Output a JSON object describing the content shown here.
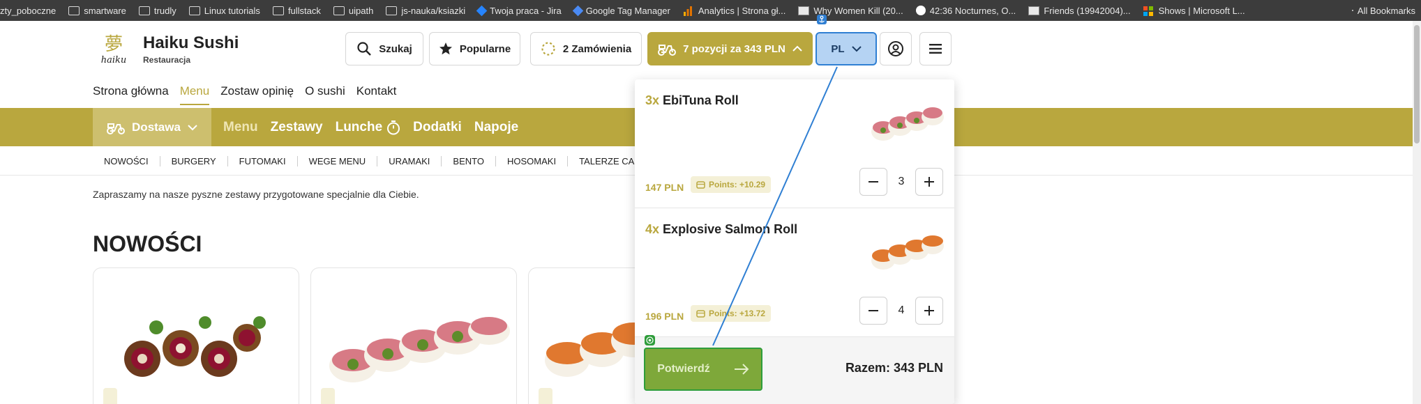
{
  "browser": {
    "bookmarks": [
      {
        "label": "zty_poboczne",
        "icon": "folder-icon"
      },
      {
        "label": "smartware",
        "icon": "folder-icon"
      },
      {
        "label": "trudly",
        "icon": "folder-icon"
      },
      {
        "label": "Linux tutorials",
        "icon": "folder-icon"
      },
      {
        "label": "fullstack",
        "icon": "folder-icon"
      },
      {
        "label": "uipath",
        "icon": "folder-icon"
      },
      {
        "label": "js-nauka/ksiazki",
        "icon": "folder-icon"
      },
      {
        "label": "Twoja praca - Jira",
        "icon": "jira-icon"
      },
      {
        "label": "Google Tag Manager",
        "icon": "gtm-icon"
      },
      {
        "label": "Analytics | Strona gł...",
        "icon": "analytics-icon"
      },
      {
        "label": "Why Women Kill (20...",
        "icon": "site-icon"
      },
      {
        "label": "42:36 Nocturnes, O...",
        "icon": "google-icon"
      },
      {
        "label": "Friends (19942004)...",
        "icon": "site-icon"
      },
      {
        "label": "Shows | Microsoft L...",
        "icon": "microsoft-icon"
      }
    ],
    "all_bookmarks": "All Bookmarks"
  },
  "brand": {
    "title": "Haiku Sushi",
    "subtitle": "Restauracja",
    "logo_text": "haiku"
  },
  "header": {
    "search": "Szukaj",
    "popular": "Popularne",
    "orders": "2 Zamówienia",
    "cart": "7 pozycji za 343 PLN",
    "language": "PL"
  },
  "topnav": [
    "Strona główna",
    "Menu",
    "Zostaw opinię",
    "O sushi",
    "Kontakt"
  ],
  "goldbar": {
    "delivery": "Dostawa",
    "items": [
      "Menu",
      "Zestawy",
      "Lunche",
      "Dodatki",
      "Napoje"
    ]
  },
  "subcategories": [
    "NOWOŚCI",
    "BURGERY",
    "FUTOMAKI",
    "WEGE MENU",
    "URAMAKI",
    "BENTO",
    "HOSOMAKI",
    "TALERZE CA"
  ],
  "intro": "Zapraszamy na nasze pyszne zestawy przygotowane specjalnie dla Ciebie.",
  "section_title": "NOWOŚCI",
  "cart_dropdown": {
    "items": [
      {
        "qty_label": "3x",
        "name": "EbiTuna Roll",
        "price": "147 PLN",
        "points": "Points: +10.29",
        "quantity": "3"
      },
      {
        "qty_label": "4x",
        "name": "Explosive Salmon Roll",
        "price": "196 PLN",
        "points": "Points: +13.72",
        "quantity": "4"
      }
    ],
    "confirm": "Potwierdź",
    "total": "Razem: 343 PLN"
  },
  "colors": {
    "gold": "#b9a73e",
    "confirm_green": "#7ea83a",
    "highlight_blue": "#2f7fd3"
  }
}
